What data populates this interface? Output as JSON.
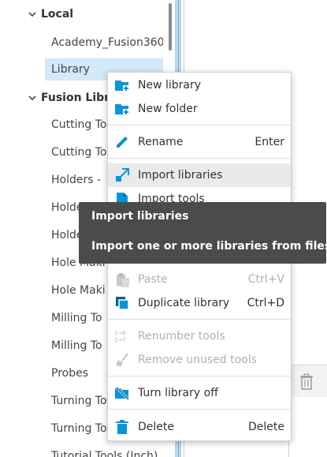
{
  "tree": {
    "sections": [
      {
        "label": "Local",
        "expanded": true
      },
      {
        "label": "Fusion Libra",
        "expanded": true
      }
    ],
    "local_items": [
      {
        "label": "Academy_Fusion360",
        "selected": false
      },
      {
        "label": "Library",
        "selected": true
      }
    ],
    "fusion_items": [
      "Cutting To",
      "Cutting To",
      "Holders - ",
      "Holde",
      "Holde",
      "Hole Maki",
      "Hole Maki",
      "Milling To",
      "Milling To",
      "Probes",
      "Turning To",
      "Turning To",
      "Tutorial Tools (Inch)"
    ]
  },
  "context_menu": {
    "items": [
      {
        "label": "New library",
        "shortcut": "",
        "icon": "new-library-icon",
        "disabled": false
      },
      {
        "label": "New folder",
        "shortcut": "",
        "icon": "new-folder-icon",
        "disabled": false
      },
      {
        "label": "Rename",
        "shortcut": "Enter",
        "icon": "pencil-icon",
        "disabled": false
      },
      {
        "label": "Import libraries",
        "shortcut": "",
        "icon": "import-libraries-icon",
        "disabled": false,
        "hover": true
      },
      {
        "label": "Import tools",
        "shortcut": "",
        "icon": "import-tools-icon",
        "disabled": false
      },
      {
        "label": "Paste",
        "shortcut": "Ctrl+V",
        "icon": "paste-icon",
        "disabled": true
      },
      {
        "label": "Duplicate library",
        "shortcut": "Ctrl+D",
        "icon": "duplicate-icon",
        "disabled": false
      },
      {
        "label": "Renumber tools",
        "shortcut": "",
        "icon": "renumber-icon",
        "disabled": true
      },
      {
        "label": "Remove unused tools",
        "shortcut": "",
        "icon": "broom-icon",
        "disabled": true
      },
      {
        "label": "Turn library off",
        "shortcut": "",
        "icon": "library-off-icon",
        "disabled": false
      },
      {
        "label": "Delete",
        "shortcut": "Delete",
        "icon": "trash-icon",
        "disabled": false
      }
    ]
  },
  "tooltip": {
    "title": "Import libraries",
    "description": "Import one or more libraries from files"
  },
  "colors": {
    "accent": "#0696d7",
    "selection": "#d4e8f7",
    "tooltip_bg": "#4b4b4b"
  }
}
